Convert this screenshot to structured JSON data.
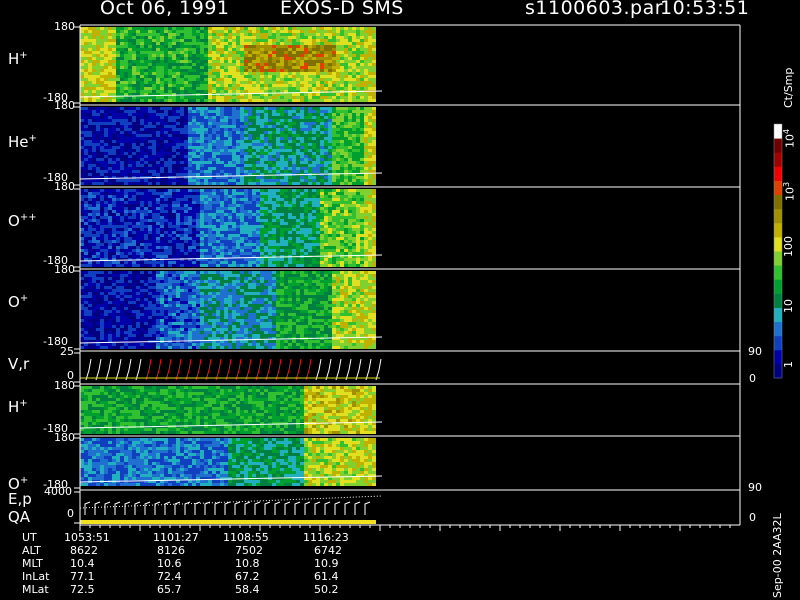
{
  "header": {
    "date": "Oct 06, 1991",
    "instrument": "EXOS-D SMS",
    "file": "s1100603.par",
    "time": "10:53:51"
  },
  "panels": [
    {
      "label": "H",
      "sup": "+",
      "top": "180",
      "bottom": "-180"
    },
    {
      "label": "He",
      "sup": "+",
      "top": "180",
      "bottom": "-180"
    },
    {
      "label": "O",
      "sup": "++",
      "top": "180",
      "bottom": "-180"
    },
    {
      "label": "O",
      "sup": "+",
      "top": "180",
      "bottom": "-180"
    },
    {
      "label": "V,r",
      "sup": "",
      "top": "25",
      "bottom": "0",
      "right_top": "90",
      "right_bottom": "0"
    },
    {
      "label": "H",
      "sup": "+",
      "top": "180",
      "bottom": "-180"
    },
    {
      "label": "O",
      "sup": "+",
      "top": "180",
      "bottom": "-180"
    },
    {
      "label": "E,p",
      "label2": "QA",
      "sup": "",
      "top": "4000",
      "bottom": "0",
      "right_top": "90",
      "right_bottom": "0"
    }
  ],
  "table": {
    "rows": [
      {
        "name": "UT",
        "values": [
          "1053:51",
          "1101:27",
          "1108:55",
          "1116:23"
        ]
      },
      {
        "name": "ALT",
        "values": [
          "8622",
          "8126",
          "7502",
          "6742"
        ]
      },
      {
        "name": "MLT",
        "values": [
          "10.4",
          "10.6",
          "10.8",
          "10.9"
        ]
      },
      {
        "name": "InLat",
        "values": [
          "77.1",
          "72.4",
          "67.2",
          "61.4"
        ]
      },
      {
        "name": "MLat",
        "values": [
          "72.5",
          "65.7",
          "58.4",
          "50.2"
        ]
      }
    ]
  },
  "colorbar": {
    "unit": "Ct/Smp",
    "labels": {
      "e4": "10",
      "e4sup": "4",
      "e3": "10",
      "e3sup": "3",
      "h100": "100",
      "t10": "10",
      "one": "1"
    },
    "colors": [
      "#000080",
      "#0000a8",
      "#1040c0",
      "#2070d0",
      "#20b0c0",
      "#008040",
      "#00a030",
      "#30c030",
      "#80d030",
      "#e0e020",
      "#c0b000",
      "#a09000",
      "#807000",
      "#e04000",
      "#f00000",
      "#a00000",
      "#700000",
      "#ffffff"
    ]
  },
  "side_label": "Sep-00 2AA32L",
  "chart_data": {
    "type": "heatmap",
    "title": "Oct 06, 1991   EXOS-D SMS",
    "x_time_labels": [
      "1053:51",
      "1101:27",
      "1108:55",
      "1116:23"
    ],
    "panels": [
      "H+",
      "He+",
      "O++",
      "O+",
      "V,r",
      "H+",
      "O+",
      "E,p QA"
    ],
    "y_range_pitch": [
      -180,
      180
    ],
    "v_range": [
      0,
      25
    ],
    "e_range": [
      0,
      4000
    ],
    "colorbar_scale": "log",
    "colorbar_range": [
      1,
      10000
    ],
    "colorbar_unit": "Ct/Smp"
  }
}
